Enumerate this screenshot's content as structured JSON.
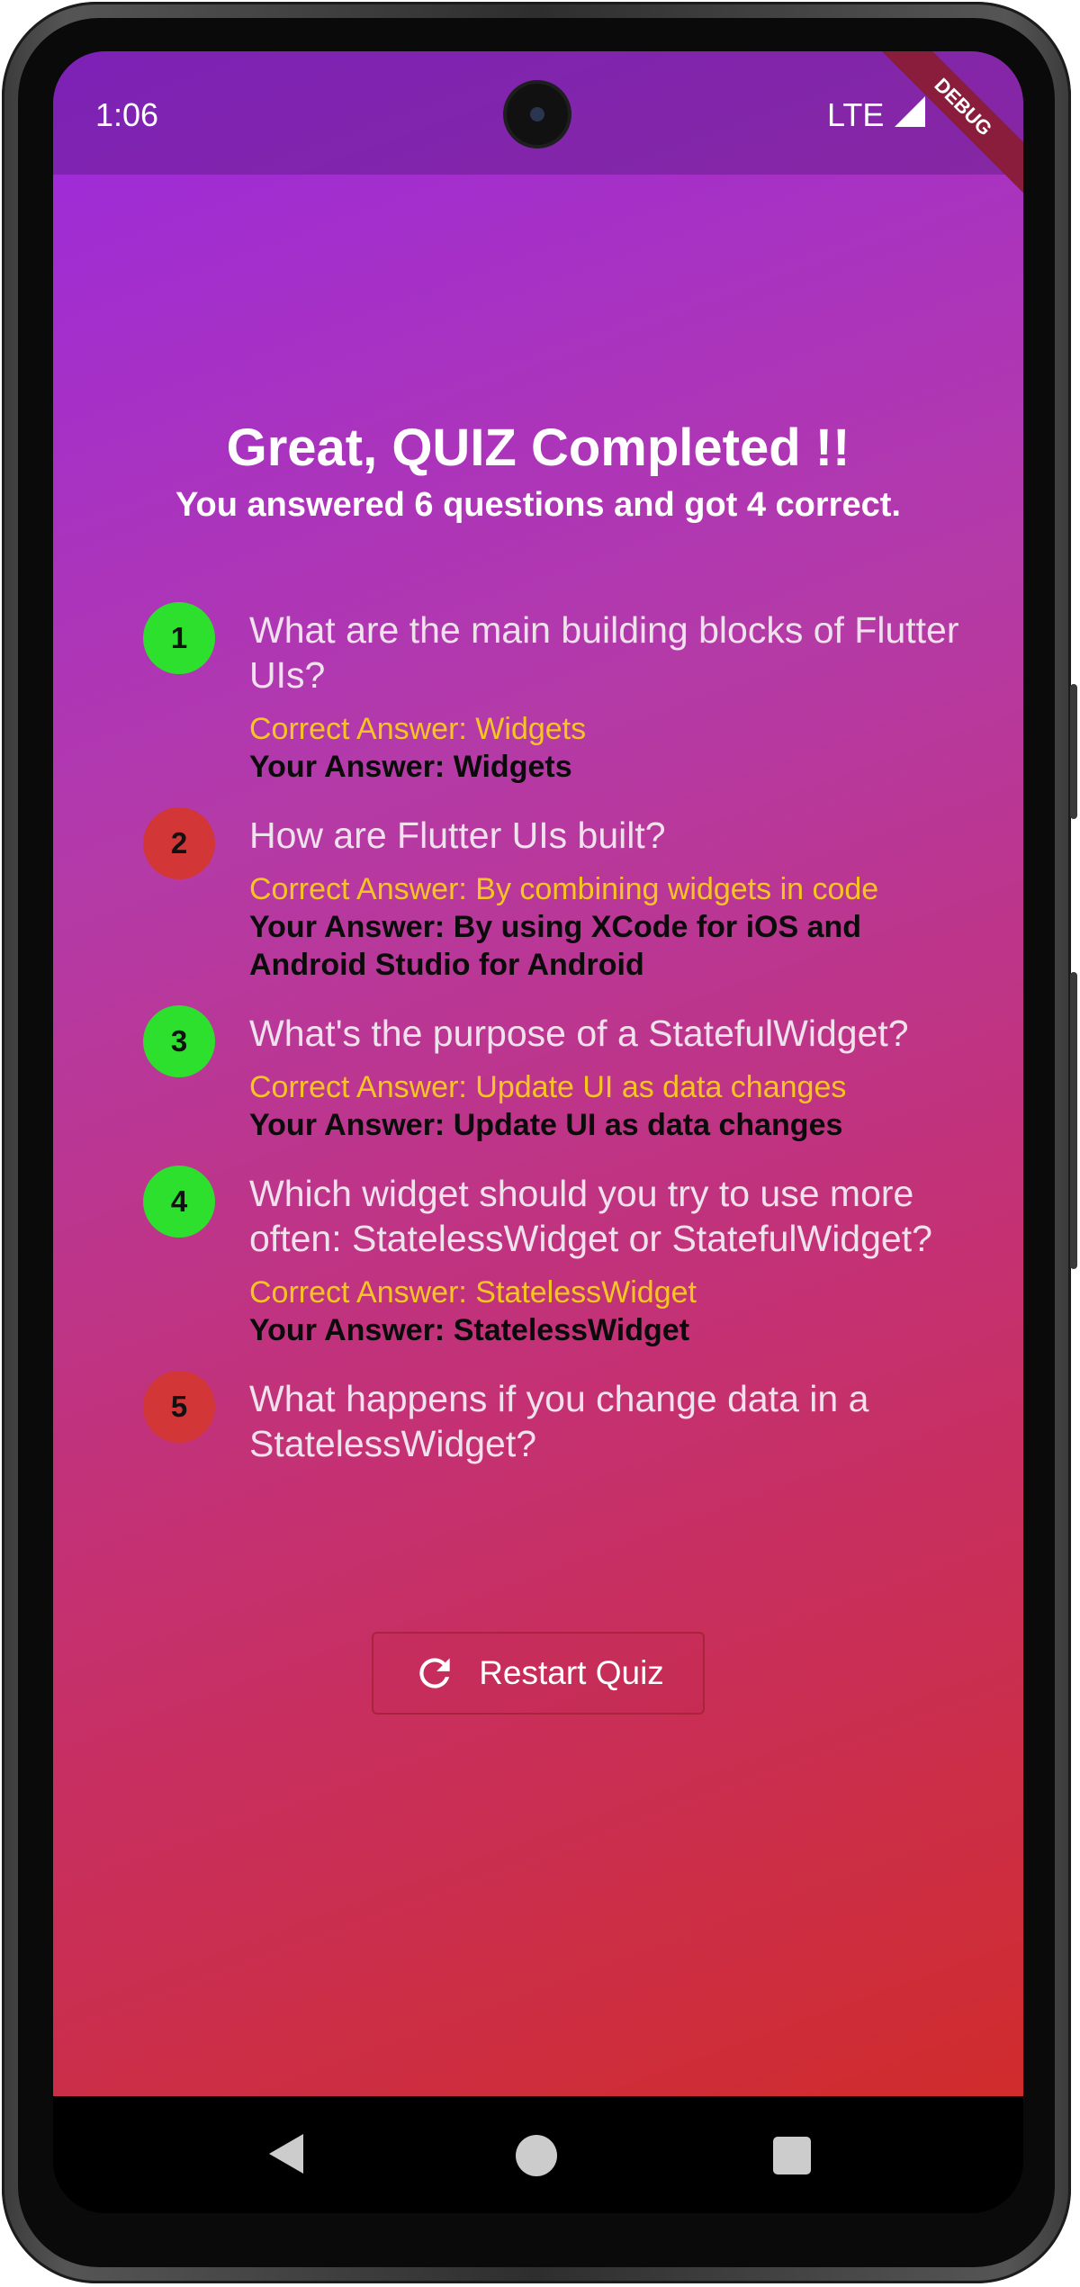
{
  "status_bar": {
    "time": "1:06",
    "network": "LTE",
    "debug_label": "DEBUG"
  },
  "results": {
    "title": "Great, QUIZ Completed !!",
    "subtitle": "You answered 6 questions and got 4 correct.",
    "items": [
      {
        "number": "1",
        "correct": true,
        "question": "What are the main building blocks of Flutter UIs?",
        "correct_answer": "Correct Answer: Widgets",
        "user_answer": "Your Answer: Widgets"
      },
      {
        "number": "2",
        "correct": false,
        "question": "How are Flutter UIs built?",
        "correct_answer": "Correct Answer: By combining widgets in code",
        "user_answer": "Your Answer: By using XCode for iOS and Android Studio for Android"
      },
      {
        "number": "3",
        "correct": true,
        "question": "What's the purpose of a StatefulWidget?",
        "correct_answer": "Correct Answer: Update UI as data changes",
        "user_answer": "Your Answer: Update UI as data changes"
      },
      {
        "number": "4",
        "correct": true,
        "question": "Which widget should you try to use more often: StatelessWidget or StatefulWidget?",
        "correct_answer": "Correct Answer: StatelessWidget",
        "user_answer": "Your Answer: StatelessWidget"
      },
      {
        "number": "5",
        "correct": false,
        "question": "What happens if you change data in a StatelessWidget?",
        "correct_answer": "",
        "user_answer": ""
      }
    ]
  },
  "restart_button": {
    "label": "Restart Quiz",
    "icon": "refresh-icon"
  },
  "colors": {
    "correct": "#2ee02e",
    "incorrect": "#d23636",
    "correct_answer_text": "#f7c521"
  }
}
